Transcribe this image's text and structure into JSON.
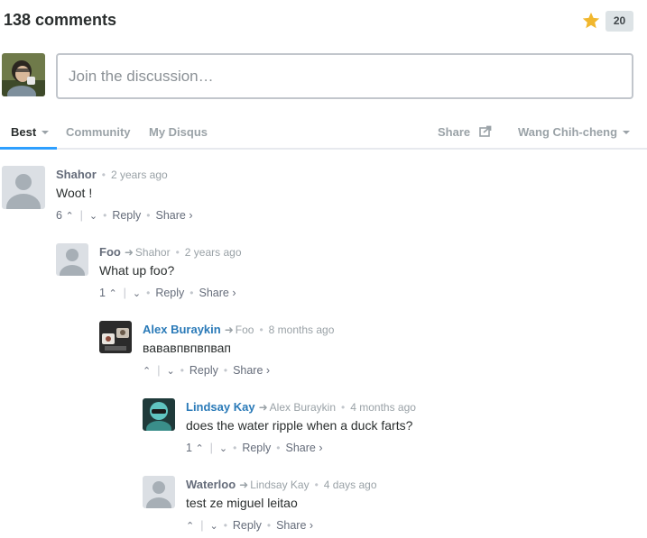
{
  "header": {
    "comment_count": "138 comments",
    "favorite_count": "20",
    "star_icon": "star-icon",
    "star_color": "#f1b72e"
  },
  "compose": {
    "placeholder": "Join the discussion…"
  },
  "nav": {
    "best": "Best",
    "community": "Community",
    "my_disqus": "My Disqus",
    "share": "Share",
    "user": "Wang Chih-cheng",
    "active_color": "#2e9fff"
  },
  "comments": [
    {
      "author": "Shahor",
      "reply_to": "",
      "time": "2 years ago",
      "text": "Woot !",
      "votes": "6",
      "reply_label": "Reply",
      "share_label": "Share ›"
    },
    {
      "author": "Foo",
      "reply_to": "Shahor",
      "time": "2 years ago",
      "text": " What up foo?",
      "votes": "1",
      "reply_label": "Reply",
      "share_label": "Share ›"
    },
    {
      "author": "Alex Buraykin",
      "reply_to": "Foo",
      "time": "8 months ago",
      "text": "вавaвпвпвпвап",
      "votes": "",
      "reply_label": "Reply",
      "share_label": "Share ›"
    },
    {
      "author": "Lindsay Kay",
      "reply_to": "Alex Buraykin",
      "time": "4 months ago",
      "text": "does the water ripple when a duck farts?",
      "votes": "1",
      "reply_label": "Reply",
      "share_label": "Share ›"
    },
    {
      "author": "Waterloo",
      "reply_to": "Lindsay Kay",
      "time": "4 days ago",
      "text": "test ze miguel leitao",
      "votes": "",
      "reply_label": "Reply",
      "share_label": "Share ›"
    }
  ]
}
